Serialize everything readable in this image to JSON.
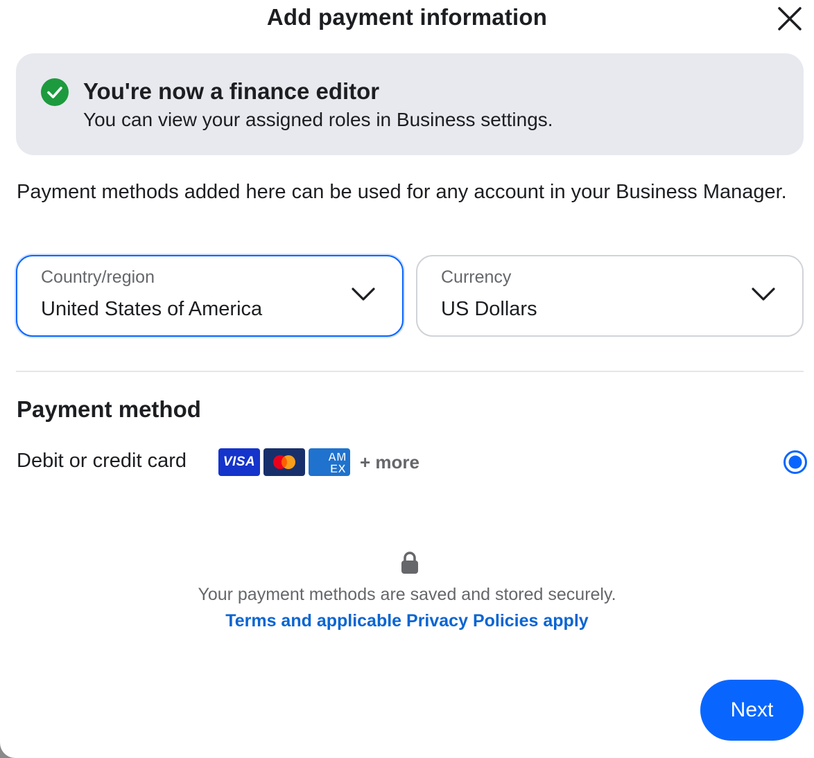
{
  "dialog": {
    "title": "Add payment information"
  },
  "icons": {
    "close": "close-icon",
    "check": "check-circle-icon",
    "chevron": "chevron-down-icon",
    "lock": "lock-icon",
    "radio": "radio-selected-icon"
  },
  "banner": {
    "title": "You're now a finance editor",
    "text": "You can view your assigned roles in Business settings."
  },
  "intro": "Payment methods added here can be used for any account in your Business Manager.",
  "country": {
    "label": "Country/region",
    "value": "United States of America"
  },
  "currency": {
    "label": "Currency",
    "value": "US Dollars"
  },
  "payment_method": {
    "heading": "Payment method",
    "option_label": "Debit or credit card",
    "card_brands": [
      "VISA",
      "Mastercard",
      "AMEX"
    ],
    "visa_text": "VISA",
    "amex_line1": "AM",
    "amex_line2": "EX",
    "more_text": "+ more",
    "selected": true
  },
  "footer": {
    "secure_text": "Your payment methods are saved and stored securely.",
    "terms_link": "Terms and applicable Privacy Policies apply",
    "next_label": "Next"
  },
  "colors": {
    "accent": "#0866ff",
    "success": "#1d9a3e",
    "banner_bg": "#e7e9ee",
    "link": "#0a65d1",
    "visa": "#1434cb",
    "mastercard_bg": "#17306b",
    "amex": "#1f72cd"
  }
}
